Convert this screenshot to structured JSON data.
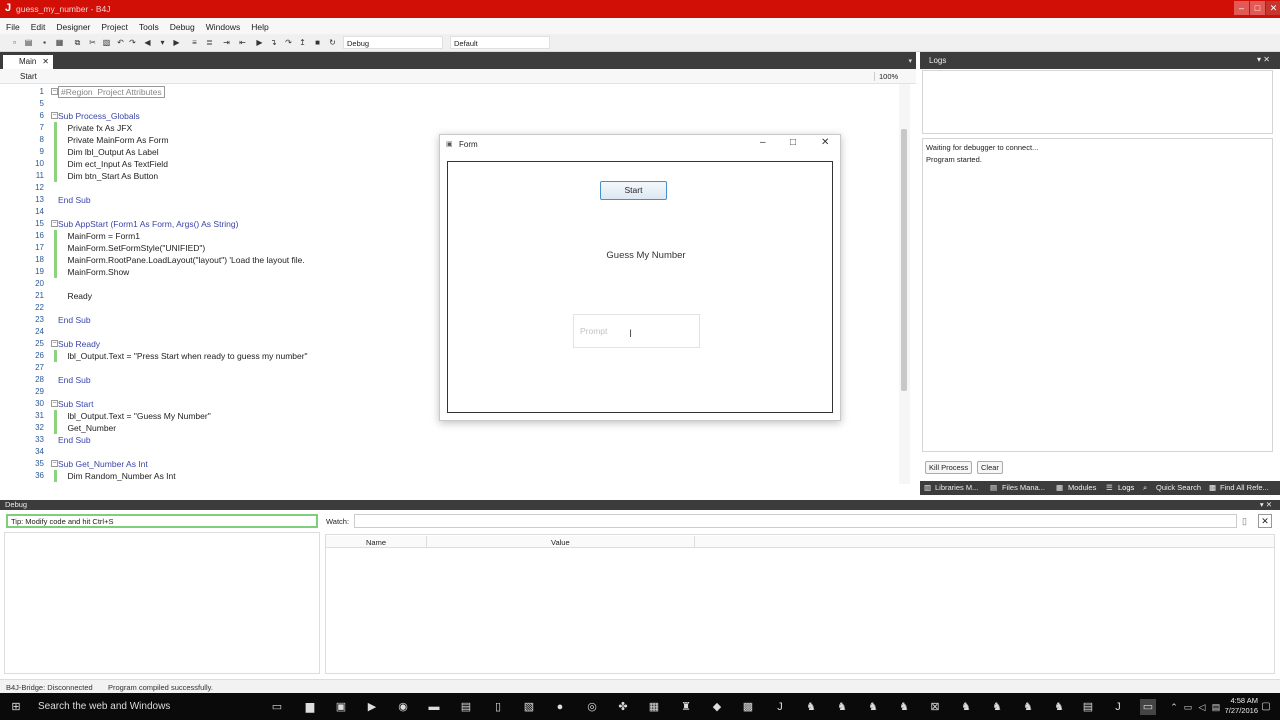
{
  "app": {
    "title": "guess_my_number - B4J",
    "icon": "J"
  },
  "menu": [
    "File",
    "Edit",
    "Designer",
    "Project",
    "Tools",
    "Debug",
    "Windows",
    "Help"
  ],
  "toolbar": {
    "config": "Debug",
    "conditional": "Default"
  },
  "editor": {
    "tab": "Main",
    "breadcrumb": "Start",
    "zoom": "100%",
    "lines": [
      {
        "n": "1",
        "text": "#Region  Project Attributes"
      },
      {
        "n": "5",
        "text": ""
      },
      {
        "n": "6",
        "text": "Sub Process_Globals"
      },
      {
        "n": "7",
        "text": "    Private fx As JFX"
      },
      {
        "n": "8",
        "text": "    Private MainForm As Form"
      },
      {
        "n": "9",
        "text": "    Dim lbl_Output As Label"
      },
      {
        "n": "10",
        "text": "    Dim ect_Input As TextField"
      },
      {
        "n": "11",
        "text": "    Dim btn_Start As Button"
      },
      {
        "n": "12",
        "text": ""
      },
      {
        "n": "13",
        "text": "End Sub"
      },
      {
        "n": "14",
        "text": ""
      },
      {
        "n": "15",
        "text": "Sub AppStart (Form1 As Form, Args() As String)"
      },
      {
        "n": "16",
        "text": "    MainForm = Form1"
      },
      {
        "n": "17",
        "text": "    MainForm.SetFormStyle(\"UNIFIED\")"
      },
      {
        "n": "18",
        "text": "    MainForm.RootPane.LoadLayout(\"layout\") 'Load the layout file."
      },
      {
        "n": "19",
        "text": "    MainForm.Show"
      },
      {
        "n": "20",
        "text": ""
      },
      {
        "n": "21",
        "text": "    Ready"
      },
      {
        "n": "22",
        "text": ""
      },
      {
        "n": "23",
        "text": "End Sub"
      },
      {
        "n": "24",
        "text": ""
      },
      {
        "n": "25",
        "text": "Sub Ready"
      },
      {
        "n": "26",
        "text": "    lbl_Output.Text = \"Press Start when ready to guess my number\""
      },
      {
        "n": "27",
        "text": ""
      },
      {
        "n": "28",
        "text": "End Sub"
      },
      {
        "n": "29",
        "text": ""
      },
      {
        "n": "30",
        "text": "Sub Start"
      },
      {
        "n": "31",
        "text": "    lbl_Output.Text = \"Guess My Number\""
      },
      {
        "n": "32",
        "text": "    Get_Number"
      },
      {
        "n": "33",
        "text": "End Sub"
      },
      {
        "n": "34",
        "text": ""
      },
      {
        "n": "35",
        "text": "Sub Get_Number As Int"
      },
      {
        "n": "36",
        "text": "    Dim Random_Number As Int"
      }
    ]
  },
  "form": {
    "title": "Form",
    "start_label": "Start",
    "output_label": "Guess My Number",
    "input_placeholder": "Prompt"
  },
  "logs": {
    "title": "Logs",
    "messages": [
      "Waiting for debugger to connect...",
      "Program started."
    ],
    "kill_label": "Kill Process",
    "clear_label": "Clear",
    "tabs": [
      "Libraries M...",
      "Files Mana...",
      "Modules",
      "Logs",
      "Quick Search",
      "Find All Refe..."
    ]
  },
  "debug": {
    "title": "Debug",
    "tip": "Tip: Modify code and hit Ctrl+S",
    "watch_label": "Watch:",
    "col_name": "Name",
    "col_value": "Value"
  },
  "status": {
    "bridge": "B4J-Bridge: Disconnected",
    "message": "Program compiled successfully."
  },
  "taskbar": {
    "search": "Search the web and Windows",
    "time": "4:58 AM",
    "date": "7/27/2016"
  }
}
